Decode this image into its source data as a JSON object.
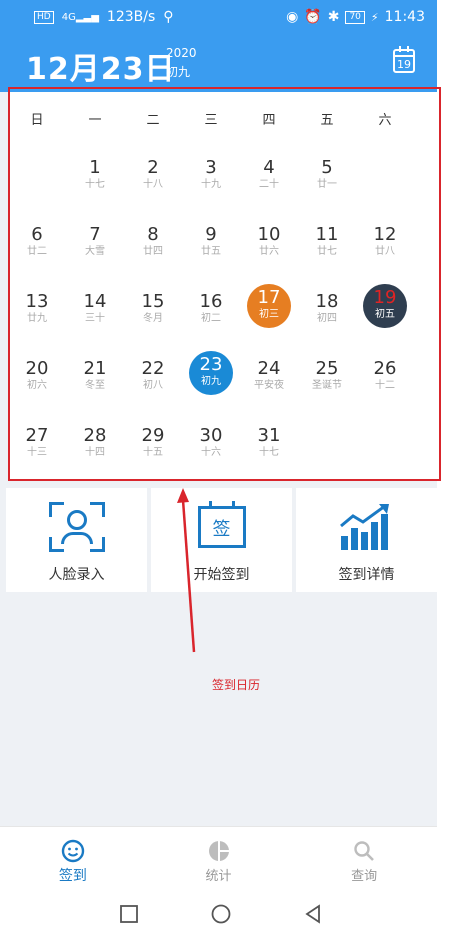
{
  "status_bar": {
    "network": "HD",
    "net_type": "4G",
    "speed": "123B/s",
    "battery": "70",
    "time": "11:43"
  },
  "header": {
    "date": "12月23日",
    "year": "2020",
    "lunar": "初九",
    "calendar_icon_day": "19"
  },
  "calendar": {
    "weekdays": [
      "日",
      "一",
      "二",
      "三",
      "四",
      "五",
      "六"
    ],
    "weeks": [
      [
        null,
        {
          "d": "1",
          "l": "十七"
        },
        {
          "d": "2",
          "l": "十八"
        },
        {
          "d": "3",
          "l": "十九"
        },
        {
          "d": "4",
          "l": "二十"
        },
        {
          "d": "5",
          "l": "廿一"
        },
        null
      ],
      [
        {
          "d": "6",
          "l": "廿二"
        },
        {
          "d": "7",
          "l": "大雪"
        },
        {
          "d": "8",
          "l": "廿四"
        },
        {
          "d": "9",
          "l": "廿五"
        },
        {
          "d": "10",
          "l": "廿六"
        },
        {
          "d": "11",
          "l": "廿七"
        },
        {
          "d": "12",
          "l": "廿八"
        }
      ],
      [
        {
          "d": "13",
          "l": "廿九"
        },
        {
          "d": "14",
          "l": "三十"
        },
        {
          "d": "15",
          "l": "冬月"
        },
        {
          "d": "16",
          "l": "初二"
        },
        {
          "d": "17",
          "l": "初三",
          "style": "orange"
        },
        {
          "d": "18",
          "l": "初四"
        },
        {
          "d": "19",
          "l": "初五",
          "style": "dark"
        }
      ],
      [
        {
          "d": "20",
          "l": "初六"
        },
        {
          "d": "21",
          "l": "冬至"
        },
        {
          "d": "22",
          "l": "初八"
        },
        {
          "d": "23",
          "l": "初九",
          "style": "blue"
        },
        {
          "d": "24",
          "l": "平安夜"
        },
        {
          "d": "25",
          "l": "圣诞节"
        },
        {
          "d": "26",
          "l": "十二"
        }
      ],
      [
        {
          "d": "27",
          "l": "十三"
        },
        {
          "d": "28",
          "l": "十四"
        },
        {
          "d": "29",
          "l": "十五"
        },
        {
          "d": "30",
          "l": "十六"
        },
        {
          "d": "31",
          "l": "十七"
        },
        null,
        null
      ]
    ]
  },
  "actions": {
    "face": "人脸录入",
    "start": "开始签到",
    "details": "签到详情",
    "sign_glyph": "签"
  },
  "annotation": "签到日历",
  "tabs": {
    "checkin": "签到",
    "stats": "统计",
    "query": "查询"
  },
  "colors": {
    "primary": "#3a9cf0",
    "accent_blue": "#1a8ad6",
    "orange": "#e67e22",
    "dark": "#2f3e50",
    "annotation_red": "#d9252c"
  }
}
